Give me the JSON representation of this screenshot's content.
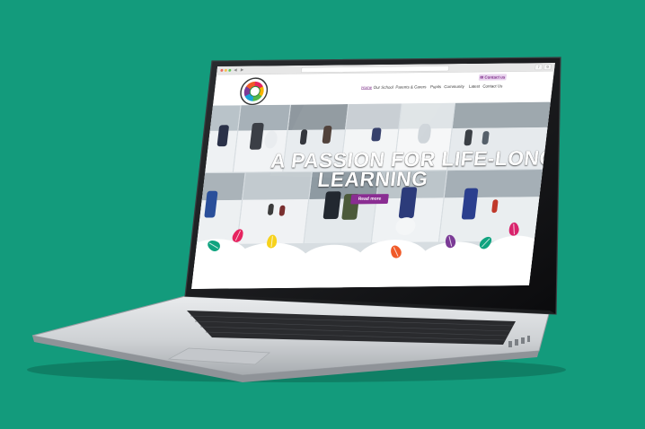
{
  "background_color": "#139b7c",
  "browser": {
    "nav_arrows": "◀ ▶",
    "button_icons": [
      "share-icon",
      "tabs-icon"
    ]
  },
  "website": {
    "contact_button_label": "Contact us",
    "contact_icon": "envelope-icon",
    "logo_icon": "school-tree-logo-icon",
    "nav_items": [
      {
        "label": "Home",
        "active": true
      },
      {
        "label": "Our School",
        "active": false
      },
      {
        "label": "Parents & Carers",
        "active": false
      },
      {
        "label": "Pupils",
        "active": false
      },
      {
        "label": "Community",
        "active": false
      },
      {
        "label": "Latest",
        "active": false
      },
      {
        "label": "Contact Us",
        "active": false
      }
    ],
    "hero": {
      "title_line1": "A PASSION FOR LIFE-LONG",
      "title_line2": "LEARNING",
      "button_label": "Read more"
    },
    "accent_color": "#8a2d92",
    "leaf_colors": [
      "#0fa37f",
      "#e6235f",
      "#f7d21c",
      "#f05a28",
      "#7b3a96",
      "#d9236c"
    ]
  },
  "laptop": {
    "body_color": "#cfd2d5",
    "bezel_color": "#0d0d0f"
  }
}
